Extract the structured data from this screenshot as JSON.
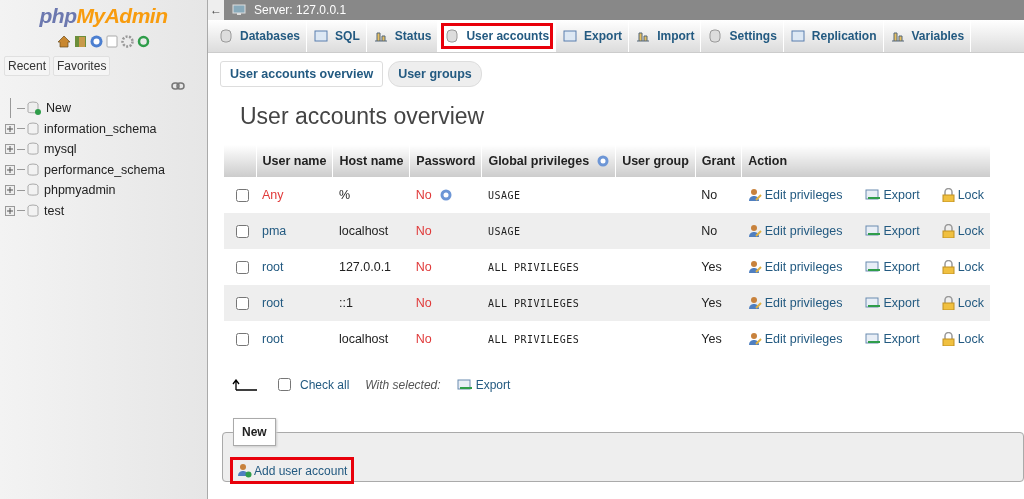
{
  "sidebar": {
    "logo": {
      "part_1": "php",
      "part_2": "MyAdmin"
    },
    "tabs": [
      {
        "label": "Recent",
        "selected": false
      },
      {
        "label": "Favorites",
        "selected": false
      }
    ],
    "tree": [
      {
        "label": "New",
        "kind": "new"
      },
      {
        "label": "information_schema",
        "kind": "db",
        "expanded": false
      },
      {
        "label": "mysql",
        "kind": "db",
        "expanded": false
      },
      {
        "label": "performance_schema",
        "kind": "db",
        "expanded": false
      },
      {
        "label": "phpmyadmin",
        "kind": "db",
        "expanded": false
      },
      {
        "label": "test",
        "kind": "db",
        "expanded": false
      }
    ]
  },
  "collapse_arrow": "←",
  "breadcrumb": "Server: 127.0.0.1",
  "tabs": [
    {
      "label": "Databases",
      "selected": false,
      "highlighted": false
    },
    {
      "label": "SQL",
      "selected": false,
      "highlighted": false
    },
    {
      "label": "Status",
      "selected": false,
      "highlighted": false
    },
    {
      "label": "User accounts",
      "selected": true,
      "highlighted": true
    },
    {
      "label": "Export",
      "selected": false,
      "highlighted": false
    },
    {
      "label": "Import",
      "selected": false,
      "highlighted": false
    },
    {
      "label": "Settings",
      "selected": false,
      "highlighted": false
    },
    {
      "label": "Replication",
      "selected": false,
      "highlighted": false
    },
    {
      "label": "Variables",
      "selected": false,
      "highlighted": false
    }
  ],
  "subtabs": [
    {
      "label": "User accounts overview",
      "selected": true
    },
    {
      "label": "User groups",
      "selected": false
    }
  ],
  "heading": "User accounts overview",
  "table": {
    "columns": [
      "User name",
      "Host name",
      "Password",
      "Global privileges",
      "User group",
      "Grant",
      "Action"
    ],
    "rows": [
      {
        "checked": false,
        "user": "Any",
        "anonymous": true,
        "host": "%",
        "password": "No",
        "password_help": true,
        "privileges": "USAGE",
        "grant": "No",
        "actions": [
          "Edit privileges",
          "Export",
          "Lock"
        ]
      },
      {
        "checked": false,
        "user": "pma",
        "anonymous": false,
        "host": "localhost",
        "password": "No",
        "password_help": false,
        "privileges": "USAGE",
        "grant": "No",
        "actions": [
          "Edit privileges",
          "Export",
          "Lock"
        ]
      },
      {
        "checked": false,
        "user": "root",
        "anonymous": false,
        "host": "127.0.0.1",
        "password": "No",
        "password_help": false,
        "privileges": "ALL PRIVILEGES",
        "grant": "Yes",
        "actions": [
          "Edit privileges",
          "Export",
          "Lock"
        ]
      },
      {
        "checked": false,
        "user": "root",
        "anonymous": false,
        "host": "::1",
        "password": "No",
        "password_help": false,
        "privileges": "ALL PRIVILEGES",
        "grant": "Yes",
        "actions": [
          "Edit privileges",
          "Export",
          "Lock"
        ]
      },
      {
        "checked": false,
        "user": "root",
        "anonymous": false,
        "host": "localhost",
        "password": "No",
        "password_help": false,
        "privileges": "ALL PRIVILEGES",
        "grant": "Yes",
        "actions": [
          "Edit privileges",
          "Export",
          "Lock"
        ]
      }
    ]
  },
  "bulk": {
    "check_all": {
      "label": "Check all",
      "checked": false
    },
    "with_selected": "With selected:",
    "export": "Export"
  },
  "new_section": {
    "legend": "New",
    "add_link": {
      "label": "Add user account",
      "highlighted": true
    }
  }
}
